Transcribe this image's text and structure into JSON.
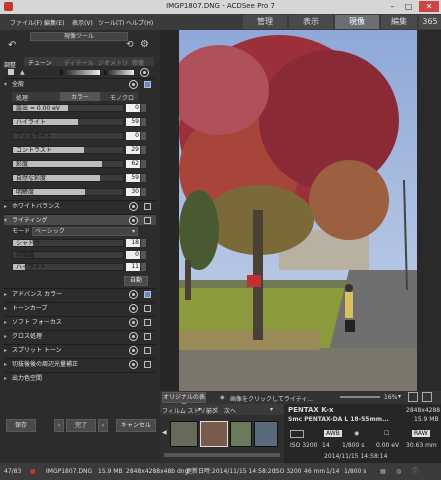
{
  "window": {
    "title": "IMGP1807.DNG - ACDSee Pro 7"
  },
  "menu": [
    "ファイル(F)",
    "編集(E)",
    "表示(V)",
    "ツール(T)",
    "ヘルプ(H)"
  ],
  "modes": [
    "管理",
    "表示",
    "現像",
    "編集",
    "365"
  ],
  "left": {
    "preset": "現像ツール",
    "tabs": [
      "チューン",
      "ディテール",
      "ジオメトリ",
      "修復"
    ],
    "tune_header": "調整",
    "general": {
      "title": "全般",
      "sub_tabs": [
        "処理",
        "カラー",
        "モノクロ"
      ],
      "sliders": [
        {
          "label": "露出 = 0.00 eV",
          "value": "0",
          "level": 0.5
        },
        {
          "label": "ハイライト",
          "value": "59",
          "level": 0.59
        },
        {
          "label": "フィルライト",
          "value": "0",
          "level": 0.0
        },
        {
          "label": "コントラスト",
          "value": "29",
          "level": 0.645
        },
        {
          "label": "彩度",
          "value": "62",
          "level": 0.81
        },
        {
          "label": "自然な彩度",
          "value": "59",
          "level": 0.795
        },
        {
          "label": "明瞭度",
          "value": "30",
          "level": 0.65
        }
      ]
    },
    "white_balance": "ホワイトバランス",
    "lighting": {
      "title": "ライティング",
      "mode_label": "モード",
      "mode_value": "ベーシック",
      "sliders": [
        {
          "label": "シャドウ",
          "value": "18",
          "level": 0.18
        },
        {
          "label": "中間調",
          "value": "0",
          "level": 0.0
        },
        {
          "label": "ハイライト",
          "value": "11",
          "level": 0.11
        }
      ],
      "auto": "自動"
    },
    "sections": [
      "アドバンス カラー",
      "トーンカーブ",
      "ソフト フォーカス",
      "クロス処理",
      "スプリット トーン",
      "切抜後後の周辺光量補正",
      "出力色空間"
    ],
    "buttons": {
      "save": "保存",
      "done": "完了",
      "cancel": "キャンセル"
    }
  },
  "photobar": {
    "original": "オリジナルの表示",
    "hint": "画像をクリックしてライティ...",
    "zoom": "16%"
  },
  "film": {
    "label": "フィルム ストリップ",
    "prev": "前へ",
    "next": "次へ"
  },
  "info": {
    "camera": "PENTAX K-x",
    "size1": "2848x4288",
    "lens": "Smc PENTAX-DA L 18-55mm...",
    "size2": "15.9 MB",
    "iso": "ISO 3200",
    "ev": "14",
    "shutter": "1/800 s",
    "ev2": "0.00 eV",
    "focal": "30.63 mm",
    "date": "2014/11/15 14:58:14",
    "wb": "AWB",
    "raw": "RAW"
  },
  "status": {
    "index": "47/83",
    "name": "IMGP1807.DNG",
    "size": "15.9 MB",
    "dims": "2848x4288x48b dng",
    "date_label": "更新日時:",
    "date": "2014/11/15 14:58:20",
    "iso": "ISO 3200",
    "focal": "46 mm",
    "shutter": "1/14",
    "time": "1/800 s"
  }
}
